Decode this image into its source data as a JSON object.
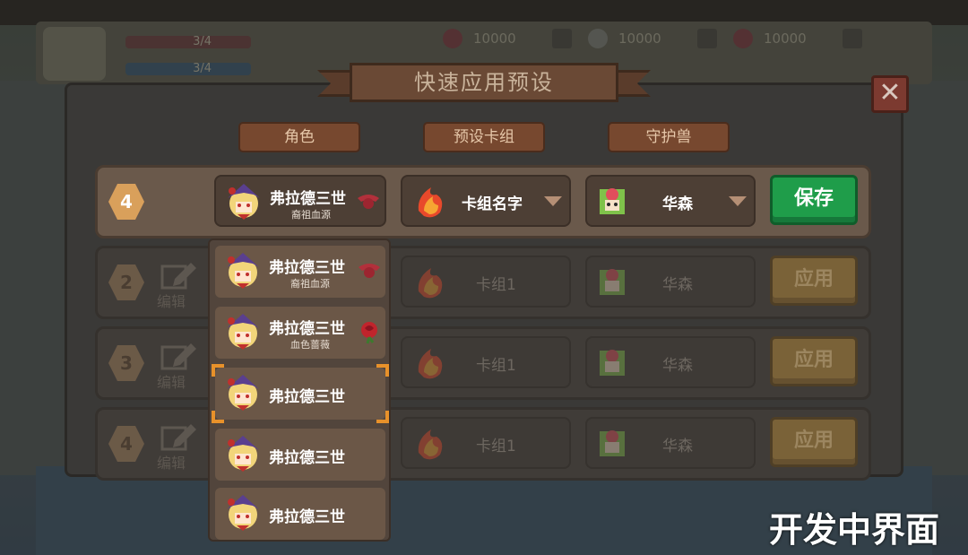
{
  "hud": {
    "hp_text": "3/4",
    "mp_text": "3/4",
    "resources": [
      {
        "icon": "gem-icon",
        "value": "10000",
        "color": "#8a4a4a"
      },
      {
        "icon": "orb-icon",
        "value": "10000",
        "color": "#8b8b7e"
      },
      {
        "icon": "heart-gem-icon",
        "value": "10000",
        "color": "#8a4a4a"
      }
    ]
  },
  "dialog": {
    "title": "快速应用预设",
    "close_icon": "close-icon",
    "columns": [
      "角色",
      "预设卡组",
      "守护兽"
    ]
  },
  "rows": [
    {
      "number": "4",
      "character": "弗拉德三世",
      "trait": "裔祖血源",
      "deck": "卡组名字",
      "pet": "华森",
      "action": "保存",
      "active": true
    },
    {
      "number": "2",
      "edit": "编辑",
      "deck": "卡组1",
      "pet": "华森",
      "action": "应用",
      "active": false
    },
    {
      "number": "3",
      "edit": "编辑",
      "deck": "卡组1",
      "pet": "华森",
      "action": "应用",
      "active": false
    },
    {
      "number": "4",
      "edit": "编辑",
      "deck": "卡组1",
      "pet": "华森",
      "action": "应用",
      "active": false
    }
  ],
  "character_options": [
    {
      "name": "弗拉德三世",
      "trait": "裔祖血源",
      "trait_icon": "bat-wing-icon"
    },
    {
      "name": "弗拉德三世",
      "trait": "血色蔷薇",
      "trait_icon": "rose-icon"
    },
    {
      "name": "弗拉德三世",
      "trait": "",
      "selected": true
    },
    {
      "name": "弗拉德三世",
      "trait": ""
    },
    {
      "name": "弗拉德三世",
      "trait": ""
    }
  ],
  "colors": {
    "save_button": "#1f9d4a",
    "apply_button": "#7a6238",
    "header_tag": "#77482f",
    "selection_corner": "#e8912a"
  },
  "watermark": "开发中界面"
}
